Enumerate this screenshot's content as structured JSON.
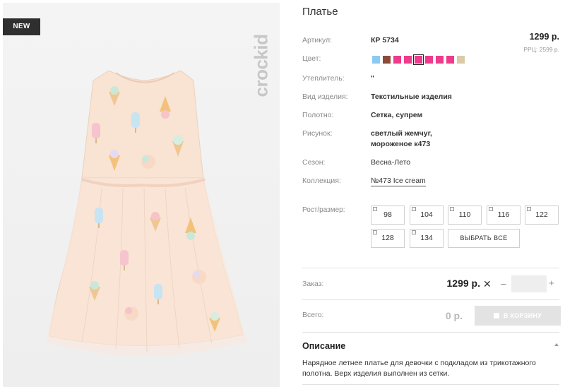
{
  "badge": {
    "new": "NEW"
  },
  "brand": {
    "logo_text": "crockid"
  },
  "product": {
    "title": "Платье",
    "article": {
      "label": "Артикул:",
      "value": "КР 5734"
    },
    "color": {
      "label": "Цвет:",
      "swatches": [
        "#8ec9ef",
        "#8b4a3a",
        "#ee3b8c",
        "#ee3b8c",
        "#ee3b8c",
        "#ee3b8c",
        "#ee3b8c",
        "#ee3b8c",
        "#dacaa8"
      ],
      "selected_index": 4
    },
    "insulation": {
      "label": "Утеплитель:",
      "value": "\""
    },
    "type": {
      "label": "Вид изделия:",
      "value": "Текстильные изделия"
    },
    "fabric": {
      "label": "Полотно:",
      "value": "Сетка, супрем"
    },
    "pattern": {
      "label": "Рисунок:",
      "value_line1": "светлый жемчуг,",
      "value_line2": "мороженое к473"
    },
    "season": {
      "label": "Сезон:",
      "value": "Весна-Лето"
    },
    "collection": {
      "label": "Коллекция:",
      "value": "№473 Ice cream"
    },
    "price": "1299 р.",
    "rrp": "РРЦ: 2599 р."
  },
  "sizes": {
    "label": "Рост/размер:",
    "options": [
      "98",
      "104",
      "110",
      "116",
      "122",
      "128",
      "134"
    ],
    "select_all": "ВЫБРАТЬ ВСЕ"
  },
  "order": {
    "label": "Заказ:",
    "price": "1299 р.",
    "remove_icon": "close-icon",
    "minus": "–",
    "plus": "+",
    "quantity": ""
  },
  "total": {
    "label": "Всего:",
    "value": "0 р.",
    "cart_button": "В КОРЗИНУ"
  },
  "description": {
    "title": "Описание",
    "text": "Нарядное летнее платье для девочки с подкладом из трикотажного полотна. Верх изделия выполнен из сетки."
  }
}
